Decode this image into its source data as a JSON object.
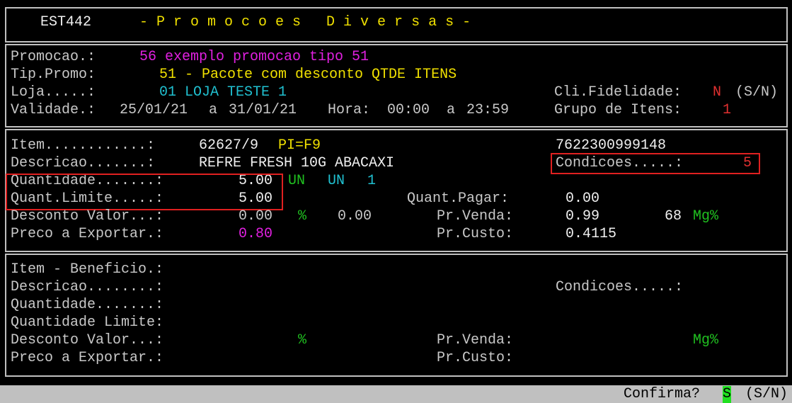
{
  "colors": {
    "label": "#c8c8c8",
    "title": "#f0e000",
    "promo": "#e020e0",
    "loja": "#20c0d0",
    "flag": "#e03030",
    "unit": "#20c020",
    "status_bg": "#c0c0c0",
    "confirm_key_bg": "#20e020",
    "highlight": "#e02020"
  },
  "header": {
    "code": "EST442",
    "title": "- P r o m o c o e s   D i v e r s a s -"
  },
  "promo": {
    "promocao_label": "Promocao.:",
    "promocao_value": "56 exemplo promocao tipo 51",
    "tipo_label": "Tip.Promo:",
    "tipo_value": "51 - Pacote com desconto QTDE ITENS",
    "loja_label": "Loja.....:",
    "loja_value": "01 LOJA TESTE 1",
    "validade_label": "Validade.:",
    "validade_from": "25/01/21",
    "validade_sep": "a",
    "validade_to": "31/01/21",
    "hora_label": "Hora:",
    "hora_from": "00:00",
    "hora_sep": "a",
    "hora_to": "23:59",
    "fidelidade_label": "Cli.Fidelidade:",
    "fidelidade_value": "N",
    "fidelidade_hint": "(S/N)",
    "grupo_label": "Grupo de Itens:",
    "grupo_value": "1"
  },
  "item": {
    "item_label": "Item............:",
    "item_value": "62627/9",
    "pi_value": "PI=F9",
    "barcode": "7622300999148",
    "descricao_label": "Descricao.......:",
    "descricao_value": "REFRE FRESH 10G ABACAXI",
    "condicoes_label": "Condicoes.....:",
    "condicoes_value": "5",
    "quantidade_label": "Quantidade.......:",
    "quantidade_value": "5.00",
    "unit1": "UN",
    "unit2": "UN",
    "unit_qty": "1",
    "quant_limite_label": "Quant.Limite.....:",
    "quant_limite_value": "5.00",
    "quant_pagar_label": "Quant.Pagar:",
    "quant_pagar_value": "0.00",
    "desconto_label": "Desconto Valor...:",
    "desconto_value": "0.00",
    "desconto_pct_sign": "%",
    "desconto_pct": "0.00",
    "pr_venda_label": "Pr.Venda:",
    "pr_venda_value": "0.99",
    "mg_value": "68",
    "mg_label": "Mg%",
    "preco_exportar_label": "Preco a Exportar.:",
    "preco_exportar_value": "0.80",
    "pr_custo_label": "Pr.Custo:",
    "pr_custo_value": "0.4115"
  },
  "beneficio": {
    "item_label": "Item - Beneficio.:",
    "descricao_label": "Descricao........:",
    "condicoes_label": "Condicoes.....:",
    "quantidade_label": "Quantidade.......:",
    "quant_limite_label": "Quantidade Limite:",
    "desconto_label": "Desconto Valor...:",
    "pct_sign": "%",
    "pr_venda_label": "Pr.Venda:",
    "mg_label": "Mg%",
    "preco_exportar_label": "Preco a Exportar.:",
    "pr_custo_label": "Pr.Custo:"
  },
  "status": {
    "prompt": "Confirma?",
    "key": "S",
    "hint": "(S/N)"
  }
}
